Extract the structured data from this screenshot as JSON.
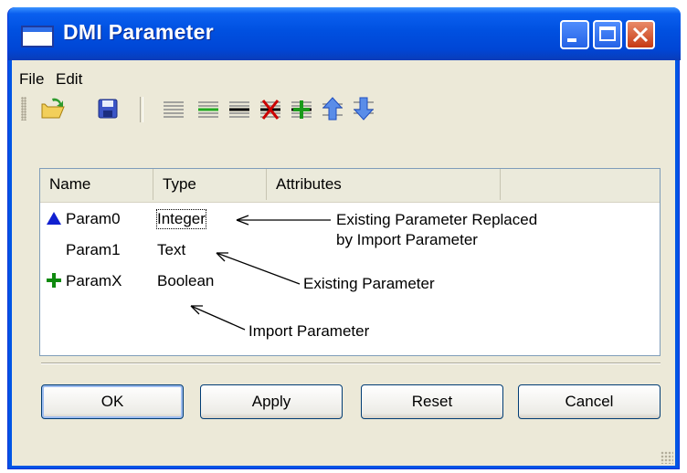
{
  "window": {
    "title": "DMI Parameter"
  },
  "menu": [
    "File",
    "Edit"
  ],
  "toolbar": {
    "icons": [
      "open-folder-icon",
      "save-icon",
      "list-icon",
      "list-add-line-icon",
      "list-line-icon",
      "delete-param-icon",
      "add-param-icon",
      "move-up-icon",
      "move-down-icon"
    ]
  },
  "list": {
    "columns": [
      "Name",
      "Type",
      "Attributes"
    ],
    "rows": [
      {
        "name": "Param0",
        "type": "Integer",
        "marker": "triangle"
      },
      {
        "name": "Param1",
        "type": "Text",
        "marker": ""
      },
      {
        "name": "ParamX",
        "type": "Boolean",
        "marker": "plus"
      }
    ]
  },
  "annotations": {
    "replaced_line1": "Existing Parameter Replaced",
    "replaced_line2": "by Import Parameter",
    "existing": "Existing Parameter",
    "import": "Import Parameter"
  },
  "buttons": {
    "ok": "OK",
    "apply": "Apply",
    "reset": "Reset",
    "cancel": "Cancel"
  },
  "colors": {
    "titlebar": "#0050e0",
    "triangle": "#1020d0",
    "plus": "#0f8a0f",
    "delete": "#cc0000"
  }
}
